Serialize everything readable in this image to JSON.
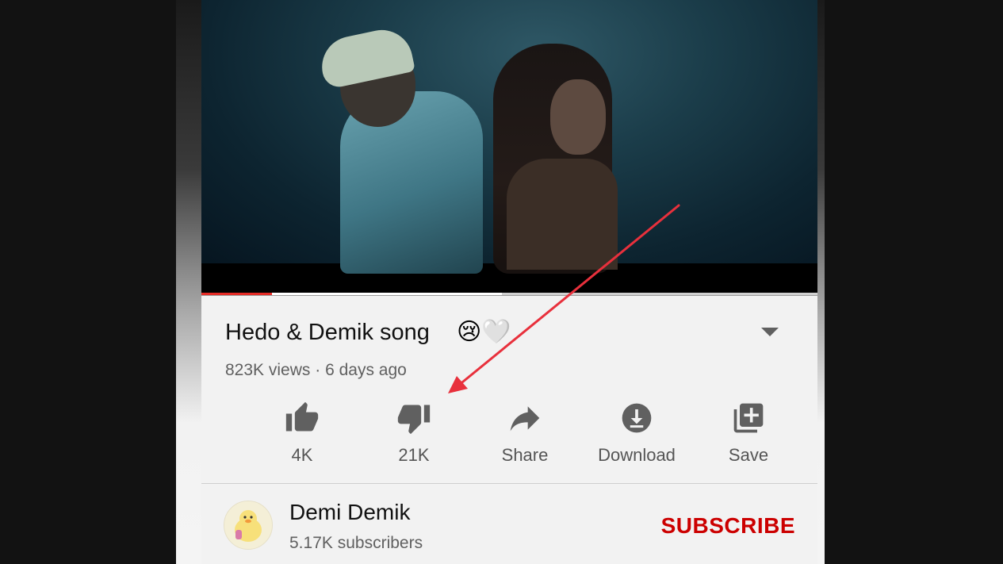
{
  "video": {
    "title": "Hedo & Demik song",
    "title_emojis": "😢🤍",
    "views": "823K views",
    "separator": "·",
    "age": "6 days ago",
    "progress_fraction": 0.115,
    "buffered_fraction": 0.488
  },
  "actions": [
    {
      "label": "4K",
      "icon": "thumbs-up-icon"
    },
    {
      "label": "21K",
      "icon": "thumbs-down-icon"
    },
    {
      "label": "Share",
      "icon": "share-icon"
    },
    {
      "label": "Download",
      "icon": "download-icon"
    },
    {
      "label": "Save",
      "icon": "add-to-playlist-icon"
    }
  ],
  "channel": {
    "name": "Demi Demik",
    "subscribers": "5.17K subscribers",
    "subscribe_label": "SUBSCRIBE"
  },
  "colors": {
    "accent_red": "#cc0000",
    "progress_red": "#e52d27",
    "annotation_arrow": "#e8303c",
    "icon_gray": "#606060"
  }
}
